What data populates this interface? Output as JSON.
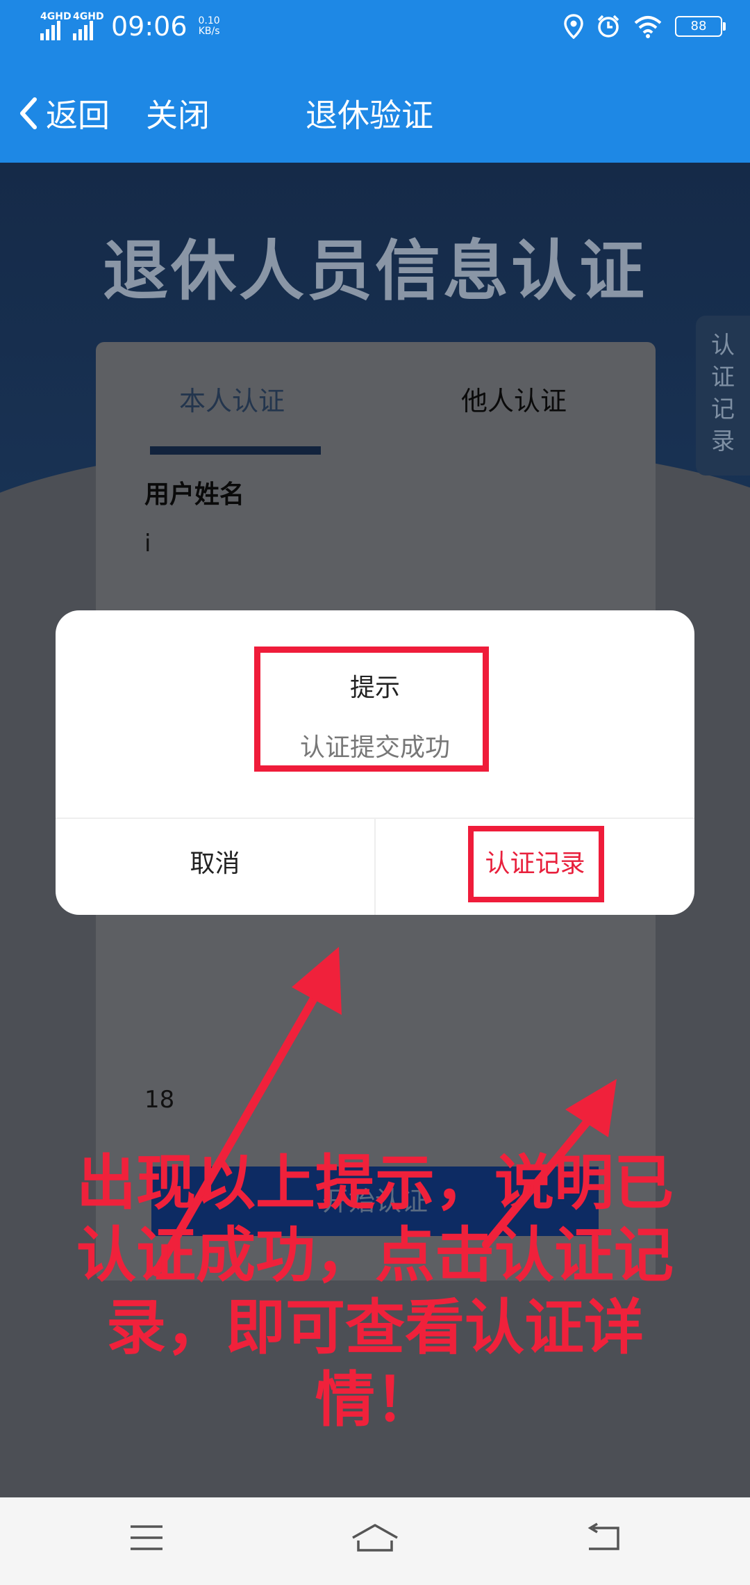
{
  "status_bar": {
    "signal_1": "4GHD",
    "signal_2": "4GHD",
    "time": "09:06",
    "speed_value": "0.10",
    "speed_unit": "KB/s",
    "battery": "88",
    "icons": [
      "location-icon",
      "alarm-icon",
      "wifi-icon",
      "battery-icon"
    ]
  },
  "nav": {
    "back_label": "返回",
    "close_label": "关闭",
    "title": "退休验证"
  },
  "page": {
    "heading": "退休人员信息认证",
    "tabs": [
      {
        "label": "本人认证",
        "active": true
      },
      {
        "label": "他人认证",
        "active": false
      }
    ],
    "name_label": "用户姓名",
    "name_value": "i",
    "age_value": "18",
    "start_button": "开始认证",
    "side_tab": [
      "认",
      "证",
      "记",
      "录"
    ]
  },
  "dialog": {
    "title": "提示",
    "message": "认证提交成功",
    "cancel_label": "取消",
    "record_label": "认证记录"
  },
  "annotation": {
    "lines": [
      "出现以上提示，说明已",
      "认证成功，点击认证记",
      "录，即可查看认证详",
      "情！"
    ]
  },
  "colors": {
    "primary": "#1e88e5",
    "highlight": "#ef1c3a",
    "dialog_bg": "#ffffff"
  }
}
